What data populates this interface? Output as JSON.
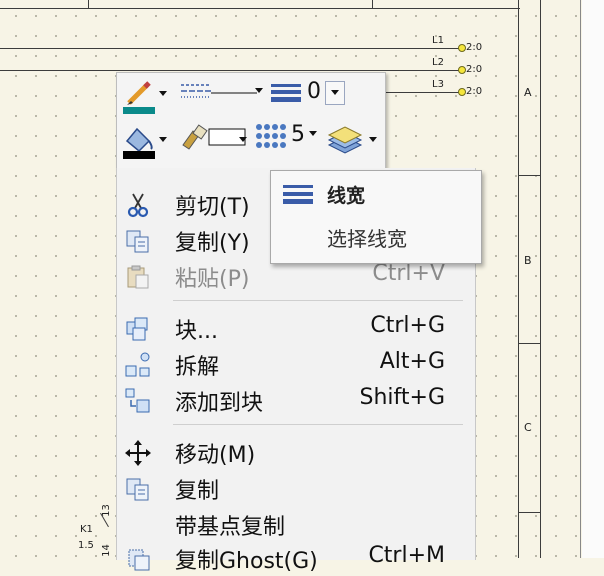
{
  "drawing": {
    "lines": [
      "L1",
      "L2",
      "L3"
    ],
    "line_value": "2:0",
    "rows": [
      "A",
      "B",
      "C"
    ],
    "component_label": "K1",
    "component_value": "1.5",
    "pin_a": "13",
    "pin_b": "14"
  },
  "toolbar": {
    "line_weight_value": "0",
    "fill_pattern_value": "5"
  },
  "tooltip": {
    "title": "线宽",
    "description": "选择线宽"
  },
  "menu": {
    "items": [
      {
        "label": "剪切(T)",
        "shortcut": "",
        "icon": "scissors-icon",
        "disabled": false
      },
      {
        "label": "复制(Y)",
        "shortcut": "",
        "icon": "copy-icon",
        "disabled": false
      },
      {
        "label": "粘贴(P)",
        "shortcut": "Ctrl+V",
        "icon": "paste-icon",
        "disabled": true
      },
      {
        "label": "块...",
        "shortcut": "Ctrl+G",
        "icon": "block-icon",
        "disabled": false
      },
      {
        "label": "拆解",
        "shortcut": "Alt+G",
        "icon": "explode-icon",
        "disabled": false
      },
      {
        "label": "添加到块",
        "shortcut": "Shift+G",
        "icon": "add-to-block-icon",
        "disabled": false
      },
      {
        "label": "移动(M)",
        "shortcut": "",
        "icon": "move-icon",
        "disabled": false
      },
      {
        "label": "复制",
        "shortcut": "",
        "icon": "copy-icon",
        "disabled": false
      },
      {
        "label": "带基点复制",
        "shortcut": "",
        "icon": "",
        "disabled": false
      },
      {
        "label": "复制Ghost(G)",
        "shortcut": "Ctrl+M",
        "icon": "ghost-copy-icon",
        "disabled": false
      }
    ]
  }
}
